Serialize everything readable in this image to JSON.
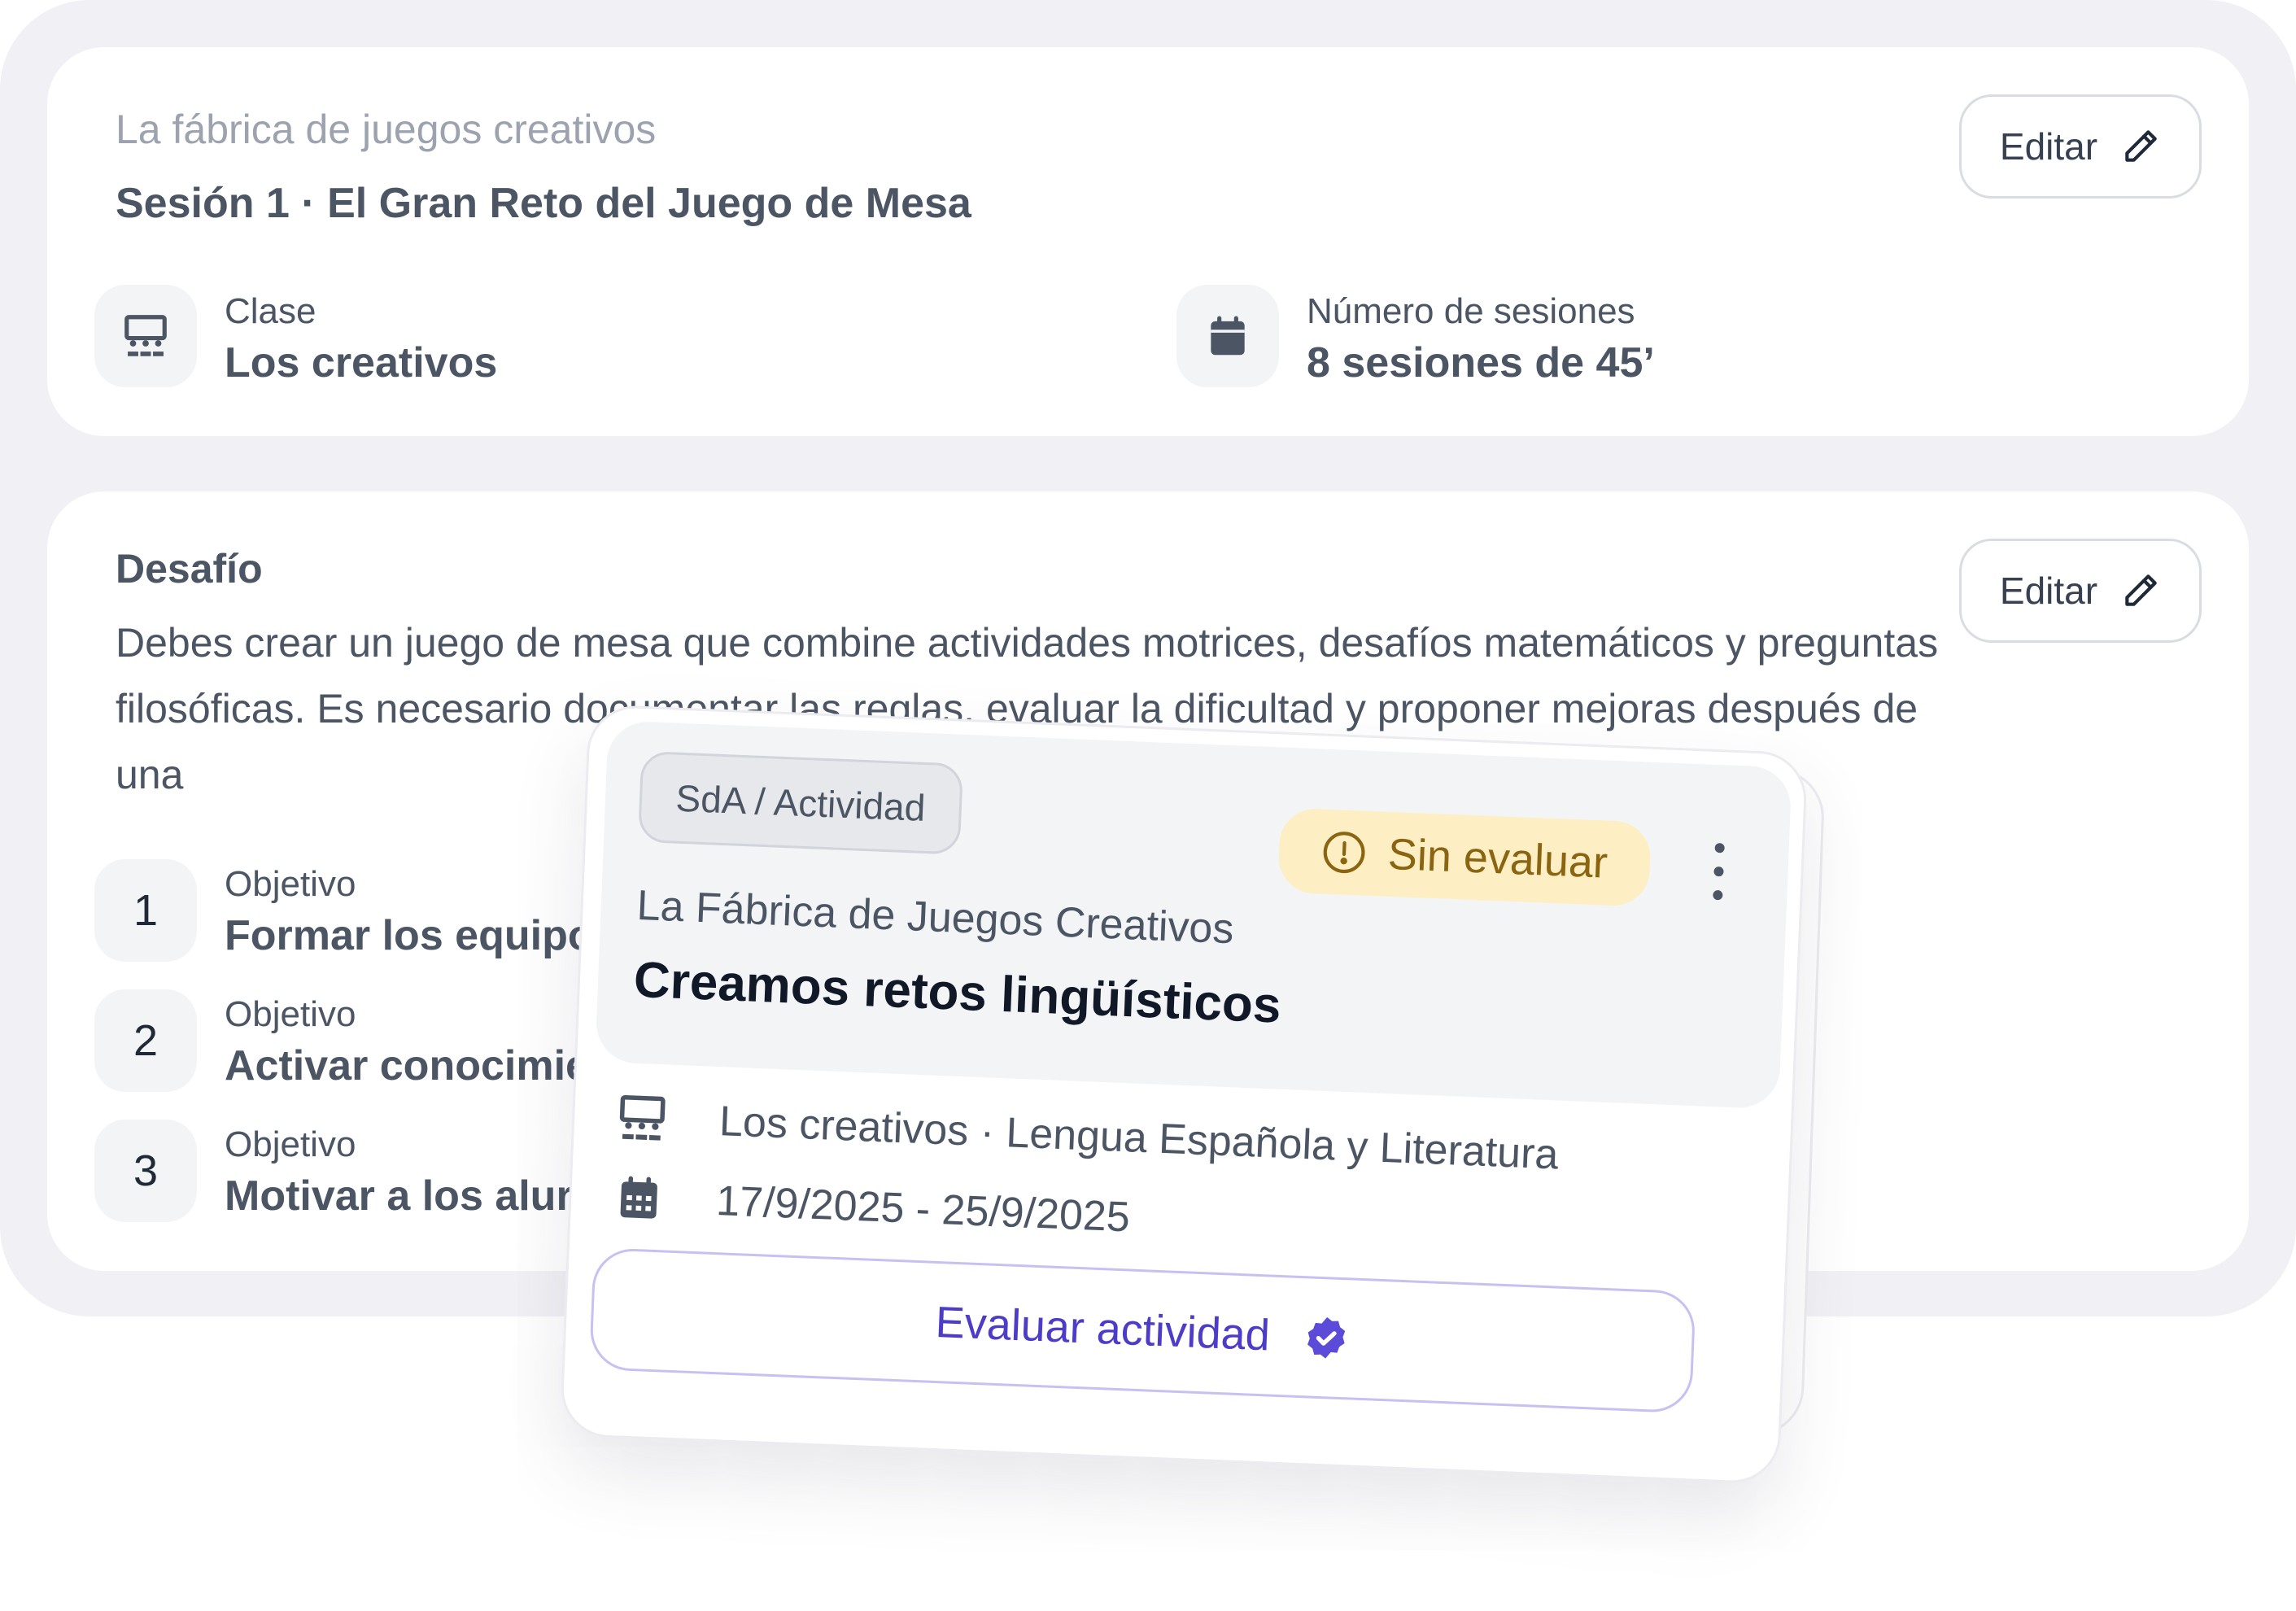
{
  "header": {
    "project_title": "La fábrica de juegos creativos",
    "session_title": "Sesión 1 · El Gran Reto del Juego de Mesa",
    "edit_label": "Editar",
    "class_label": "Clase",
    "class_value": "Los creativos",
    "sessions_label": "Número de sesiones",
    "sessions_value": "8 sesiones de 45’"
  },
  "challenge": {
    "title": "Desafío",
    "edit_label": "Editar",
    "description": "Debes crear un juego de mesa que combine actividades motrices, desafíos matemáticos y preguntas filosóficas. Es necesario documentar las reglas, evaluar la dificultad y proponer mejoras después de una",
    "objectives": [
      {
        "number": "1",
        "label": "Objetivo",
        "text": "Formar los equipo"
      },
      {
        "number": "2",
        "label": "Objetivo",
        "text": "Activar conocimie"
      },
      {
        "number": "3",
        "label": "Objetivo",
        "text": "Motivar a los alur"
      }
    ]
  },
  "activity_card": {
    "tag": "SdA / Actividad",
    "status": "Sin evaluar",
    "subtitle": "La Fábrica de Juegos Creativos",
    "title": "Creamos retos lingüísticos",
    "class_subject": "Los creativos · Lengua Española y Literatura",
    "dates": "17/9/2025 - 25/9/2025",
    "evaluate_label": "Evaluar actividad"
  },
  "icons": {
    "class": "classroom-icon",
    "calendar": "calendar-icon",
    "edit": "pencil-icon",
    "status": "alert-circle-icon",
    "menu": "kebab-menu-icon",
    "verify": "verified-badge-icon"
  },
  "colors": {
    "background": "#f1f1f5",
    "card": "#ffffff",
    "status_bg": "#fdefc3",
    "status_text": "#8a6410",
    "accent": "#4c3cc8",
    "verify": "#5b4bd8"
  }
}
